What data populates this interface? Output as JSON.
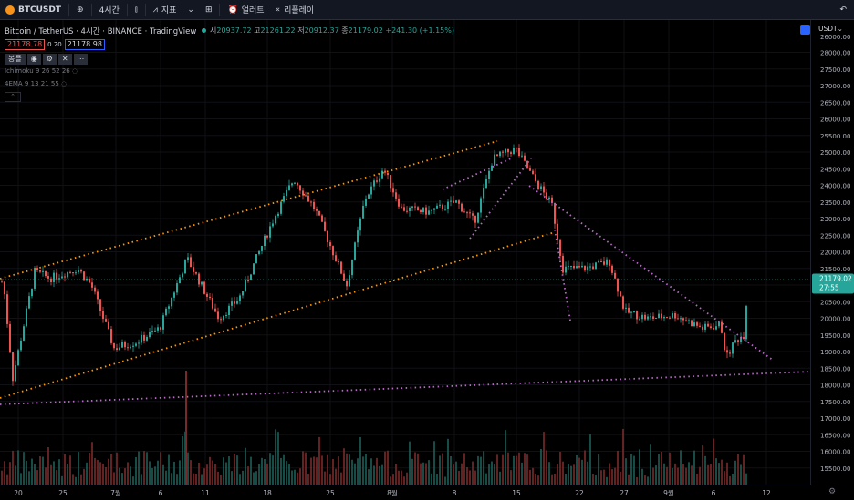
{
  "toolbar": {
    "symbol": "BTCUSDT",
    "interval": "4시간",
    "indicators_label": "지표",
    "alerts_label": "얼러트",
    "replay_label": "리플레이"
  },
  "legend": {
    "title": "Bitcoin / TetherUS · 4시간 · BINANCE · TradingView",
    "o_label": "시",
    "o": "20937.72",
    "h_label": "고",
    "h": "21261.22",
    "l_label": "저",
    "l": "20912.37",
    "c_label": "종",
    "c": "21179.02",
    "change": "+241.30 (+1.15%)",
    "sell_price": "21178.78",
    "spread": "0.20",
    "buy_price": "21178.98",
    "series_label": "봉플",
    "indicator1": "Ichimoku 9 26 52 26",
    "indicator2": "4EMA 9 13 21 55"
  },
  "price_scale": {
    "currency": "USDT",
    "ticks": [
      "26000.00",
      "28000.00",
      "27500.00",
      "27000.00",
      "26500.00",
      "26000.00",
      "25500.00",
      "25000.00",
      "24500.00",
      "24000.00",
      "23500.00",
      "23000.00",
      "22500.00",
      "22000.00",
      "21500.00",
      "21000.00",
      "20500.00",
      "20000.00",
      "19500.00",
      "19000.00",
      "18500.00",
      "18000.00",
      "17500.00",
      "17000.00",
      "16500.00",
      "16000.00",
      "15500.00"
    ],
    "last_price": "21179.02",
    "countdown": "27:55"
  },
  "time_scale": {
    "ticks": [
      "20",
      "25",
      "7월",
      "6",
      "11",
      "18",
      "25",
      "8월",
      "8",
      "15",
      "22",
      "27",
      "9월",
      "6",
      "12"
    ]
  },
  "colors": {
    "up": "#26a69a",
    "down": "#ef5350",
    "channel": "#ff9800",
    "trend": "#ba68c8"
  }
}
